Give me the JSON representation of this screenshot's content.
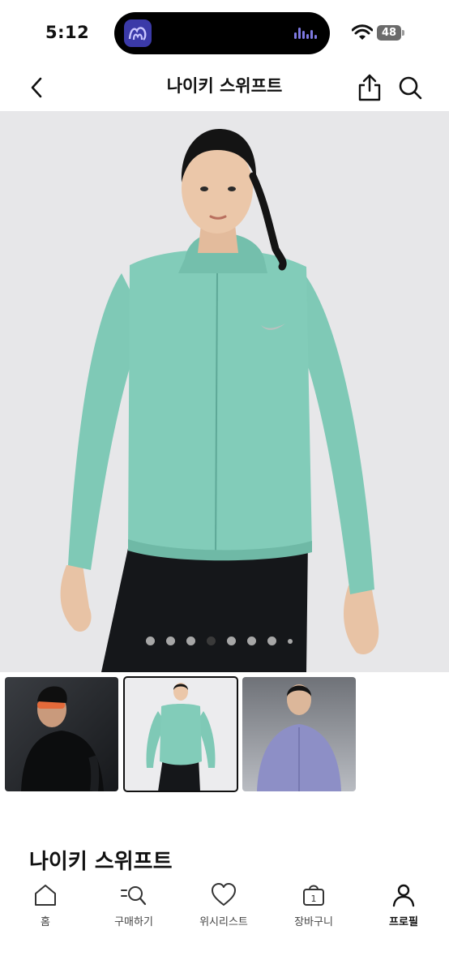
{
  "status_bar": {
    "time": "5:12",
    "battery": "48"
  },
  "header": {
    "title": "나이키 스위프트"
  },
  "icons": {
    "back": "chevron-left-icon",
    "share": "share-icon",
    "search": "search-icon",
    "home": "home-icon",
    "shop": "search-list-icon",
    "wishlist": "heart-icon",
    "cart": "shopping-bag-icon",
    "profile": "person-icon"
  },
  "gallery": {
    "dot_count": 8,
    "active_dot": 3,
    "thumbnails": [
      "black jacket",
      "mint jacket",
      "lavender jacket"
    ],
    "selected_thumbnail": 1
  },
  "product": {
    "name": "나이키 스위프트"
  },
  "tabbar": {
    "home": "홈",
    "shop": "구매하기",
    "wishlist": "위시리스트",
    "cart": "장바구니",
    "cart_count": "1",
    "profile": "프로필"
  },
  "colors": {
    "jacket_mint": "#7fc9b6",
    "background": "#e7e7e9",
    "accent": "#111111"
  }
}
